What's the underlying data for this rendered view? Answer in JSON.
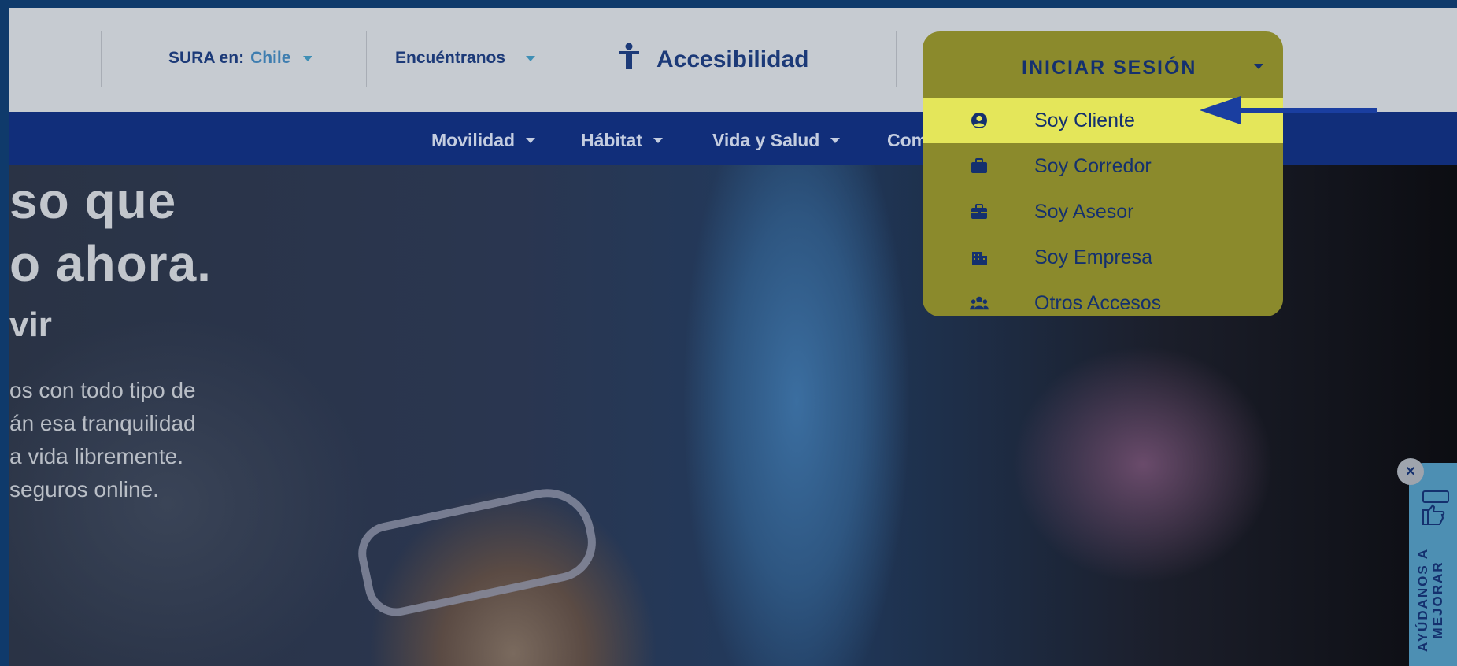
{
  "header": {
    "country_prefix": "SURA en:",
    "country": "Chile",
    "find_us": "Encuéntranos",
    "accessibility": "Accesibilidad"
  },
  "nav": {
    "items": [
      {
        "label": "Movilidad"
      },
      {
        "label": "Hábitat"
      },
      {
        "label": "Vida y Salud"
      },
      {
        "label": "Com"
      }
    ]
  },
  "login_menu": {
    "title": "INICIAR SESIÓN",
    "items": [
      {
        "label": "Soy Cliente",
        "icon": "user-circle-icon",
        "active": true
      },
      {
        "label": "Soy Corredor",
        "icon": "briefcase-icon"
      },
      {
        "label": "Soy Asesor",
        "icon": "toolbox-icon"
      },
      {
        "label": "Soy Empresa",
        "icon": "building-icon"
      },
      {
        "label": "Otros Accesos",
        "icon": "users-icon"
      }
    ]
  },
  "hero": {
    "title_line1": "so que",
    "title_line2": "o ahora.",
    "subtitle": "vir",
    "body_lines": [
      "os con todo tipo de",
      "án esa tranquilidad",
      "a vida libremente.",
      "seguros online."
    ]
  },
  "feedback": {
    "label_line1": "AYÚDANOS A",
    "label_line2": "MEJORAR",
    "close": "×"
  },
  "colors": {
    "navy": "#112e7a",
    "highlight": "#e4e65a",
    "dropdown": "#8b8a2c",
    "arrow": "#1a3ea0"
  }
}
